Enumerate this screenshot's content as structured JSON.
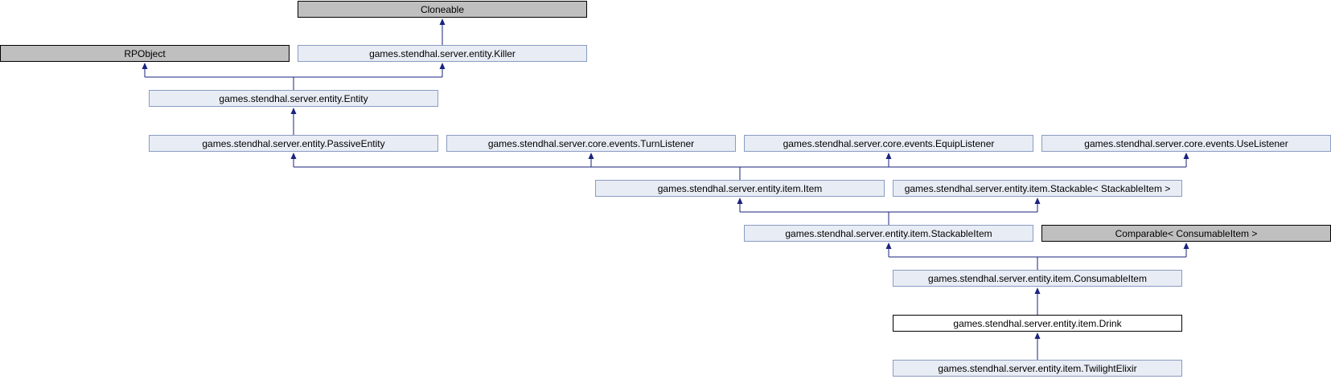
{
  "diagram": {
    "nodes": {
      "cloneable": "Cloneable",
      "rpobject": "RPObject",
      "killer": "games.stendhal.server.entity.Killer",
      "entity": "games.stendhal.server.entity.Entity",
      "passive_entity": "games.stendhal.server.entity.PassiveEntity",
      "turn_listener": "games.stendhal.server.core.events.TurnListener",
      "equip_listener": "games.stendhal.server.core.events.EquipListener",
      "use_listener": "games.stendhal.server.core.events.UseListener",
      "item": "games.stendhal.server.entity.item.Item",
      "stackable": "games.stendhal.server.entity.item.Stackable< StackableItem >",
      "stackable_item": "games.stendhal.server.entity.item.StackableItem",
      "comparable": "Comparable< ConsumableItem >",
      "consumable_item": "games.stendhal.server.entity.item.ConsumableItem",
      "drink": "games.stendhal.server.entity.item.Drink",
      "twilight_elixir": "games.stendhal.server.entity.item.TwilightElixir"
    },
    "colors": {
      "edge": "#1a237e",
      "external_fill": "#bfbfbf",
      "documented_fill": "#e8ecf4",
      "documented_border": "#8a9cc2",
      "current_fill": "#ffffff"
    }
  }
}
